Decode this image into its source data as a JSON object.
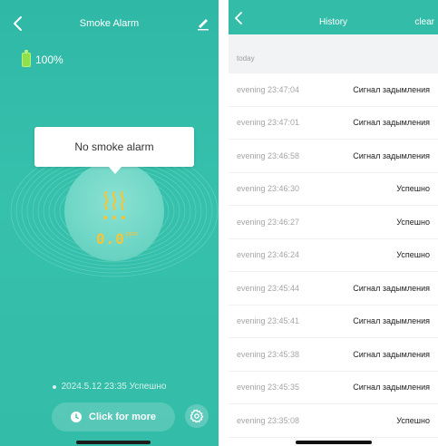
{
  "left": {
    "title": "Smoke Alarm",
    "battery": "100%",
    "alarm_message": "No smoke alarm",
    "reading_value": "0.0",
    "reading_unit": "ppm",
    "last_status": "2024.5.12 23:35 Успешно",
    "more_button": "Click for more",
    "colors": {
      "background": "#33bca8",
      "reading": "#f3c53a",
      "battery": "#8ee04d"
    }
  },
  "right": {
    "title": "History",
    "clear_label": "clear",
    "section_label": "today",
    "rows": [
      {
        "time": "evening  23:47:04",
        "event": "Сигнал задымления"
      },
      {
        "time": "evening  23:47:01",
        "event": "Сигнал задымления"
      },
      {
        "time": "evening  23:46:58",
        "event": "Сигнал задымления"
      },
      {
        "time": "evening  23:46:30",
        "event": "Успешно"
      },
      {
        "time": "evening  23:46:27",
        "event": "Успешно"
      },
      {
        "time": "evening  23:46:24",
        "event": "Успешно"
      },
      {
        "time": "evening  23:45:44",
        "event": "Сигнал задымления"
      },
      {
        "time": "evening  23:45:41",
        "event": "Сигнал задымления"
      },
      {
        "time": "evening  23:45:38",
        "event": "Сигнал задымления"
      },
      {
        "time": "evening  23:45:35",
        "event": "Сигнал задымления"
      },
      {
        "time": "evening  23:35:08",
        "event": "Успешно"
      }
    ]
  }
}
